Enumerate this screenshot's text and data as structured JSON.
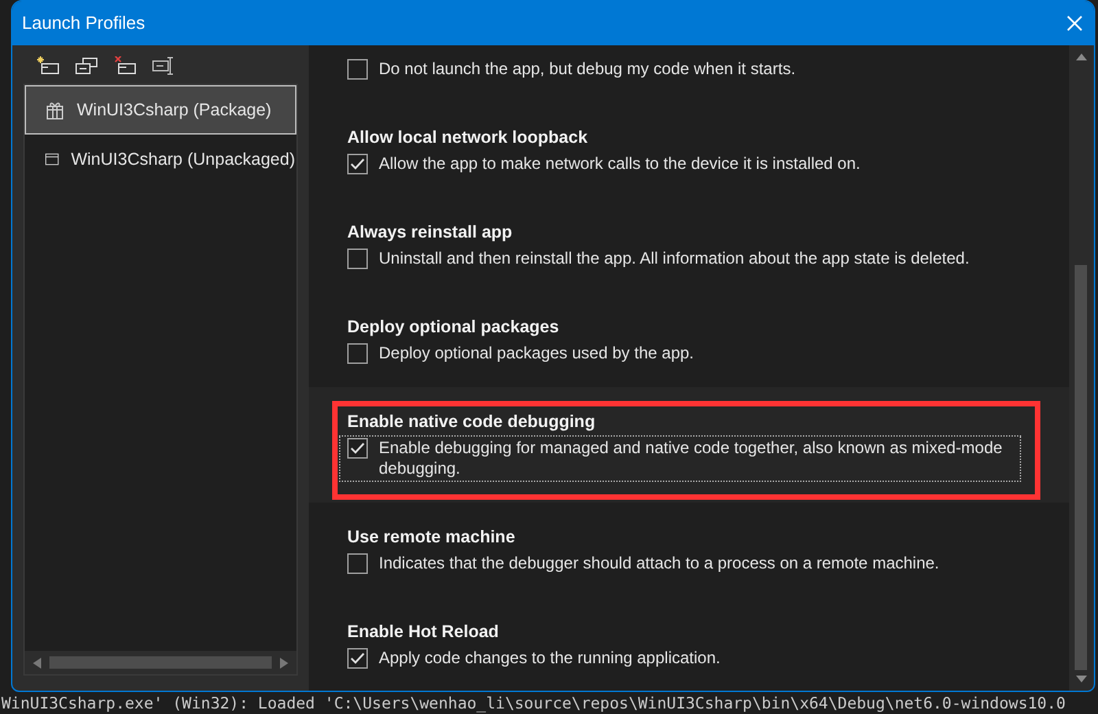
{
  "window": {
    "title": "Launch Profiles"
  },
  "profiles": [
    {
      "label": "WinUI3Csharp (Package)",
      "kind": "package",
      "selected": true
    },
    {
      "label": "WinUI3Csharp (Unpackaged)",
      "kind": "window",
      "selected": false
    }
  ],
  "settings": [
    {
      "description": "Do not launch the app, but debug my code when it starts.",
      "checked": false,
      "focused": false,
      "highlighted": false
    },
    {
      "title": "Allow local network loopback",
      "description": "Allow the app to make network calls to the device it is installed on.",
      "checked": true,
      "focused": false,
      "highlighted": false
    },
    {
      "title": "Always reinstall app",
      "description": "Uninstall and then reinstall the app. All information about the app state is deleted.",
      "checked": false,
      "focused": false,
      "highlighted": false
    },
    {
      "title": "Deploy optional packages",
      "description": "Deploy optional packages used by the app.",
      "checked": false,
      "focused": false,
      "highlighted": false
    },
    {
      "title": "Enable native code debugging",
      "description": "Enable debugging for managed and native code together, also known as mixed-mode debugging.",
      "checked": true,
      "focused": true,
      "highlighted": true
    },
    {
      "title": "Use remote machine",
      "description": "Indicates that the debugger should attach to a process on a remote machine.",
      "checked": false,
      "focused": false,
      "highlighted": false
    },
    {
      "title": "Enable Hot Reload",
      "description": "Apply code changes to the running application.",
      "checked": true,
      "focused": false,
      "highlighted": false
    }
  ],
  "background": {
    "output_line": "WinUI3Csharp.exe' (Win32): Loaded 'C:\\Users\\wenhao_li\\source\\repos\\WinUI3Csharp\\bin\\x64\\Debug\\net6.0-windows10.0"
  }
}
